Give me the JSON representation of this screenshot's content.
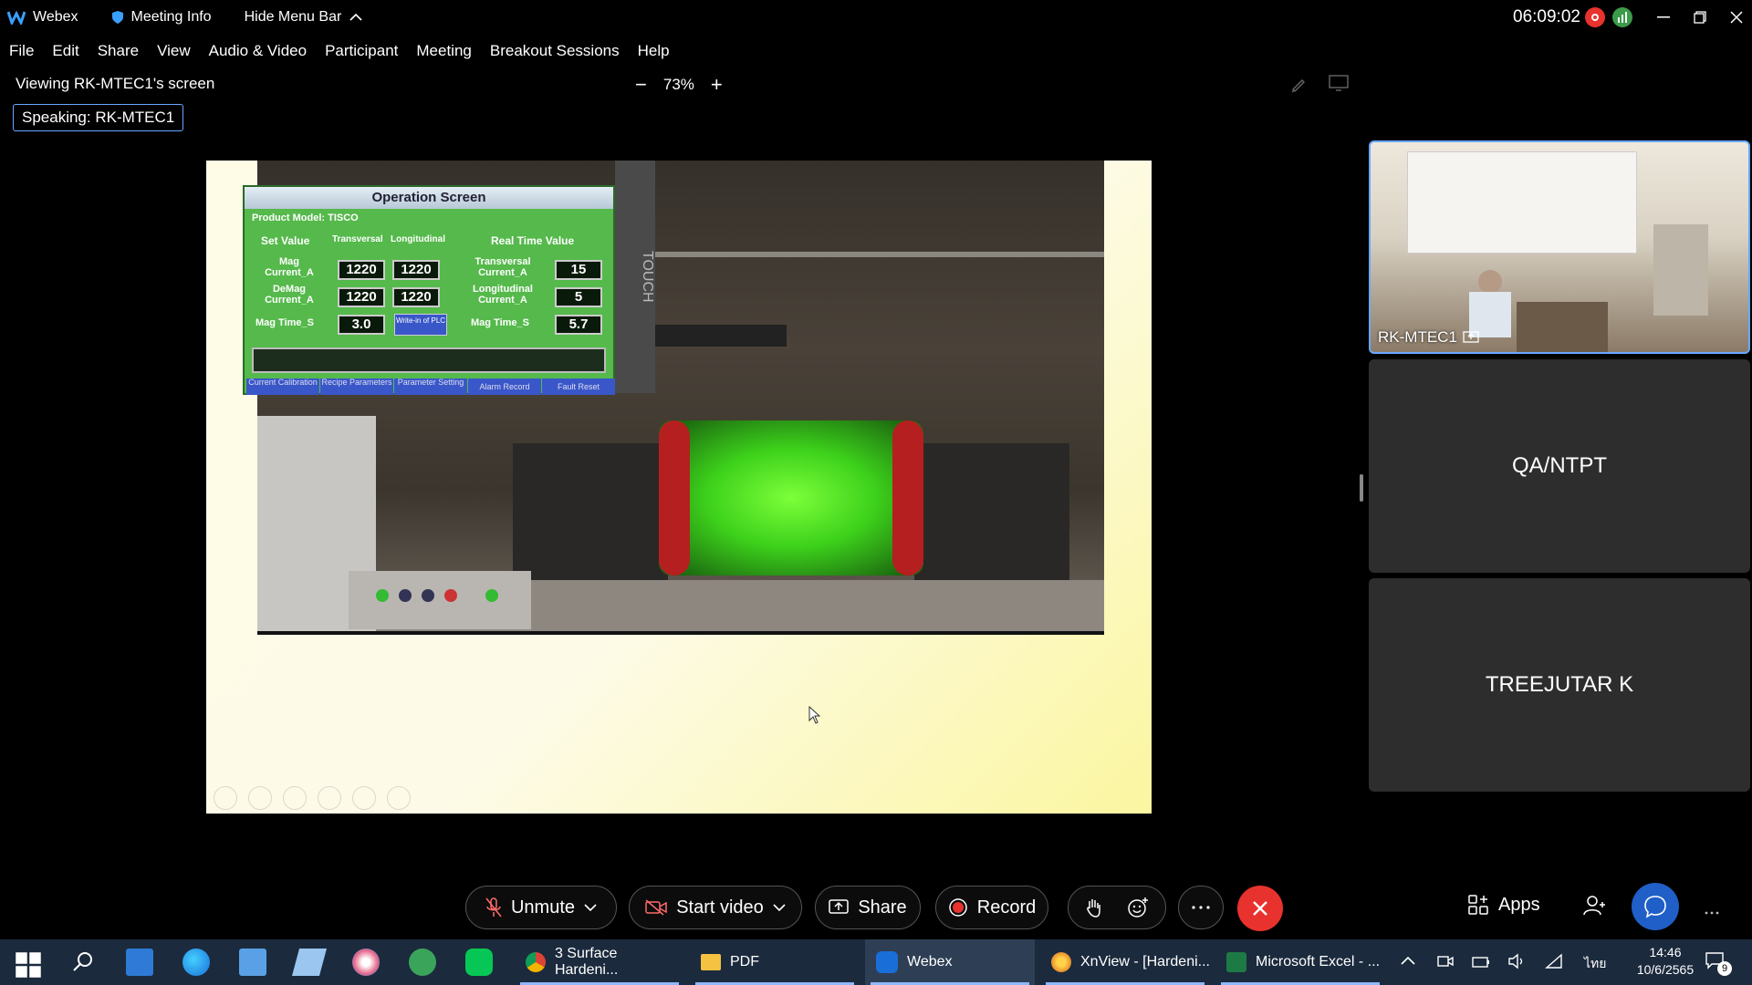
{
  "titlebar": {
    "app_name": "Webex",
    "meeting_info": "Meeting Info",
    "hide_menu_bar": "Hide Menu Bar",
    "timer": "06:09:02"
  },
  "menu": [
    "File",
    "Edit",
    "Share",
    "View",
    "Audio & Video",
    "Participant",
    "Meeting",
    "Breakout Sessions",
    "Help"
  ],
  "share": {
    "viewing": "Viewing RK-MTEC1's screen",
    "zoom": "73%",
    "speaking": "Speaking: RK-MTEC1"
  },
  "hmi": {
    "title": "Operation Screen",
    "product_model": "Product Model: TISCO",
    "set_value": "Set Value",
    "transversal": "Transversal",
    "longitudinal": "Longitudinal",
    "real_time_value": "Real Time Value",
    "mag_current": "Mag Current_A",
    "demag_current": "DeMag Current_A",
    "mag_time": "Mag Time_S",
    "transversal_current": "Transversal Current_A",
    "longitudinal_current": "Longitudinal Current_A",
    "v_mag_trans": "1220",
    "v_mag_long": "1220",
    "v_demag_trans": "1220",
    "v_demag_long": "1220",
    "v_mag_time": "3.0",
    "write_plc": "Write-in of PLC",
    "v_rt_trans": "15",
    "v_rt_long": "5",
    "v_rt_time": "5.7",
    "side_text": "TOUCH",
    "tabs": [
      "Current Calibration",
      "Recipe Parameters",
      "Parameter Setting",
      "Alarm Record",
      "Fault Reset"
    ]
  },
  "participants": {
    "active": "RK-MTEC1",
    "tile2": "QA/NTPT",
    "tile3": "TREEJUTAR K"
  },
  "controls": {
    "unmute": "Unmute",
    "start_video": "Start video",
    "share": "Share",
    "record": "Record",
    "apps": "Apps"
  },
  "taskbar": {
    "apps": [
      {
        "label": "3 Surface Hardeni..."
      },
      {
        "label": "PDF"
      },
      {
        "label": "Webex"
      },
      {
        "label": "XnView - [Hardeni..."
      },
      {
        "label": "Microsoft Excel - ..."
      }
    ],
    "lang": "ไทย",
    "time": "14:46",
    "date": "10/6/2565",
    "notifications": "9"
  },
  "colors": {
    "accent": "#6aa7ff",
    "end_call": "#e8322d",
    "taskbar": "#1b2a3d"
  }
}
